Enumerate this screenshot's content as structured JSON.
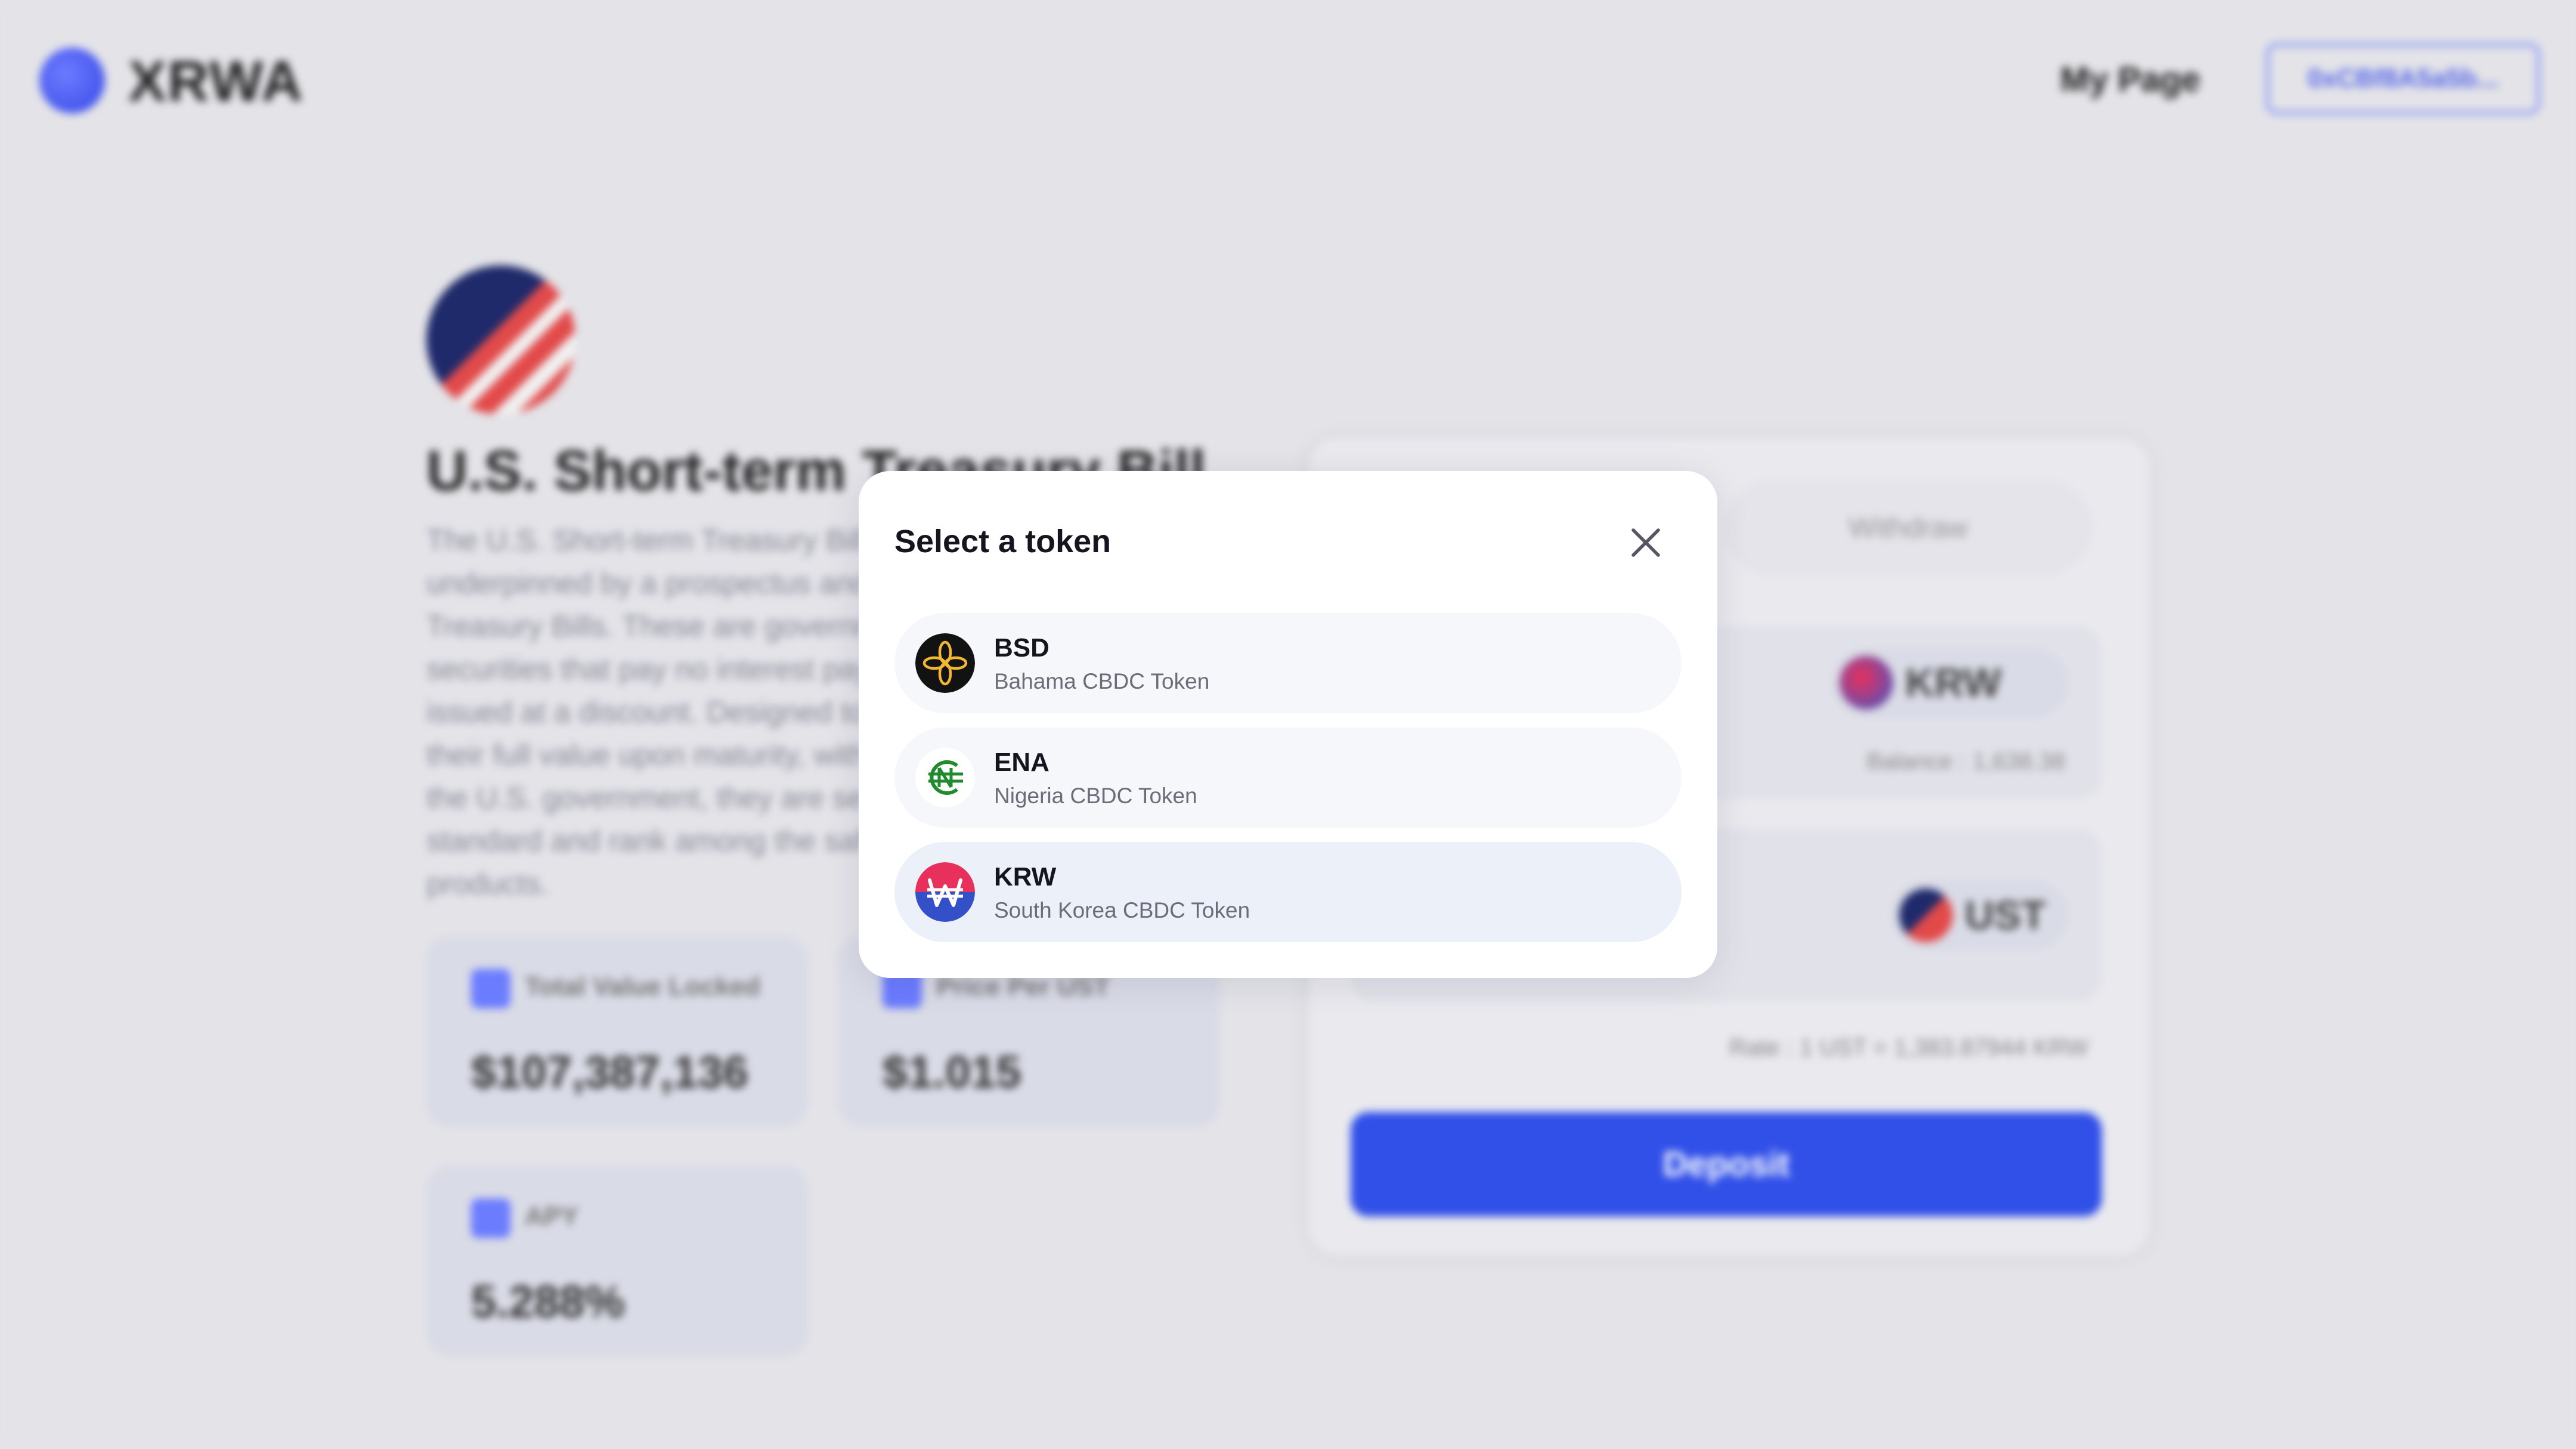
{
  "background": {
    "logo_text": "XRWA",
    "nav_mypage": "My Page",
    "nav_wallet": "0xCBf8A5a5b...",
    "asset_title": "U.S. Short-term Treasury Bill",
    "asset_description": "The U.S. Short-term Treasury Bill is a tokenized asset underpinned by a prospectus and focused on U.S. Treasury Bills. These are government-backed securities that pay no interest payments and are issued at a discount. Designed to be redeemed at their full value upon maturity, with the full backing of the U.S. government, they are seen as a \"risk-free\" standard and rank among the safest financial products.",
    "stats": [
      {
        "label": "Total Value Locked",
        "value": "$107,387,136"
      },
      {
        "label": "Price Per UST",
        "value": "$1.015"
      },
      {
        "label": "APY",
        "value": "5.288%"
      }
    ],
    "swap": {
      "tab_withdraw": "Withdraw",
      "from_token": "KRW",
      "balance_label": "Balance : 1,638.38",
      "to_token": "UST",
      "rate_text": "Rate : 1 UST = 1,383.87944 KRW",
      "deposit_label": "Deposit"
    }
  },
  "modal": {
    "title": "Select a token",
    "close_icon": "close-icon",
    "tokens": [
      {
        "symbol": "BSD",
        "name": "Bahama CBDC Token",
        "icon": "bsd-token-icon",
        "color": "#f4b731"
      },
      {
        "symbol": "ENA",
        "name": "Nigeria CBDC Token",
        "icon": "ena-token-icon",
        "color": "#1f8a2e"
      },
      {
        "symbol": "KRW",
        "name": "South Korea CBDC Token",
        "icon": "krw-token-icon",
        "color": "#e8305c",
        "selected": true
      }
    ]
  },
  "colors": {
    "accent": "#3150e8",
    "modal_bg": "#ffffff",
    "row_bg": "#f6f7fb",
    "row_selected_bg": "#ecf0f9"
  }
}
